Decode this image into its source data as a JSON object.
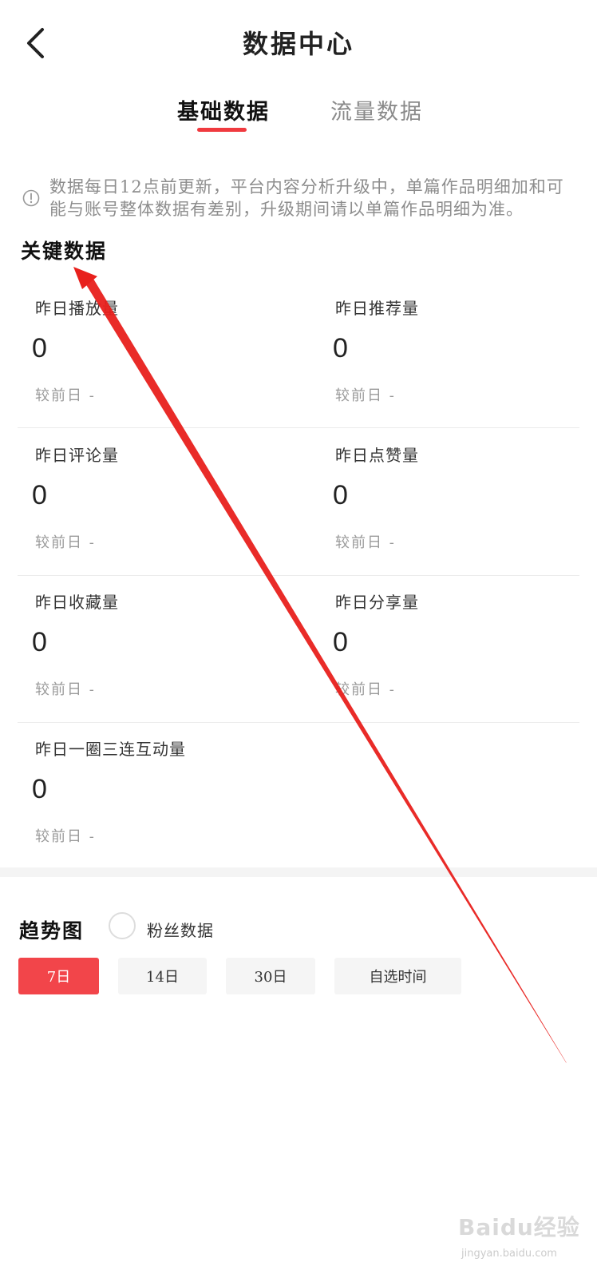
{
  "header": {
    "title": "数据中心",
    "back_icon": "chevron-left-icon"
  },
  "tabs": [
    {
      "label": "基础数据",
      "active": true
    },
    {
      "label": "流量数据",
      "active": false
    }
  ],
  "notice": {
    "icon": "info-circle-icon",
    "text": "数据每日12点前更新，平台内容分析升级中，单篇作品明细加和可能与账号整体数据有差别，升级期间请以单篇作品明细为准。"
  },
  "key_data": {
    "title": "关键数据",
    "metrics": [
      {
        "label": "昨日播放量",
        "value": "0",
        "compare": "较前日 -"
      },
      {
        "label": "昨日推荐量",
        "value": "0",
        "compare": "较前日 -"
      },
      {
        "label": "昨日评论量",
        "value": "0",
        "compare": "较前日 -"
      },
      {
        "label": "昨日点赞量",
        "value": "0",
        "compare": "较前日 -"
      },
      {
        "label": "昨日收藏量",
        "value": "0",
        "compare": "较前日 -"
      },
      {
        "label": "昨日分享量",
        "value": "0",
        "compare": "较前日 -"
      },
      {
        "label": "昨日一圈三连互动量",
        "value": "0",
        "compare": "较前日 -"
      }
    ]
  },
  "trend": {
    "title": "趋势图",
    "fans_label": "粉丝数据",
    "ranges": [
      {
        "label": "7日",
        "active": true
      },
      {
        "label": "14日",
        "active": false
      },
      {
        "label": "30日",
        "active": false
      },
      {
        "label": "自选时间",
        "active": false
      }
    ]
  },
  "colors": {
    "accent": "#f2454a",
    "annotation": "#e8201c"
  },
  "watermark": {
    "brand": "Baidu经验",
    "url": "jingyan.baidu.com"
  }
}
